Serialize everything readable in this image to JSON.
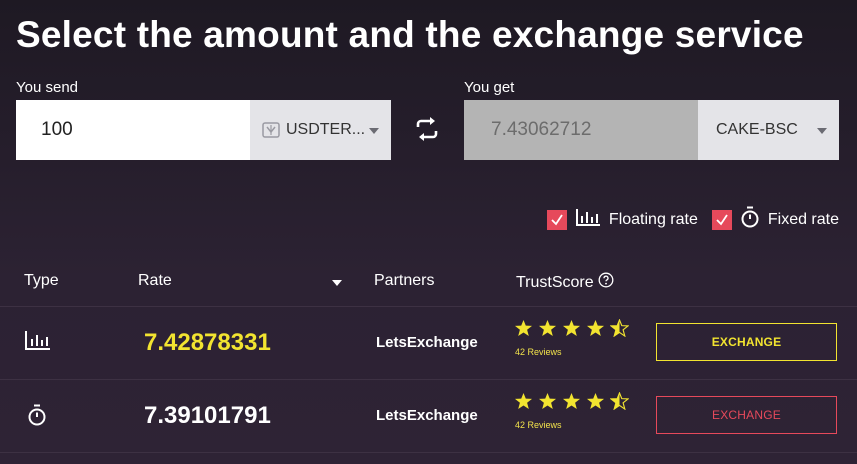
{
  "title": "Select the amount and the exchange service",
  "send": {
    "label": "You send",
    "value": "100",
    "currency": "USDTER...",
    "currency_icon": "usdt-token-icon"
  },
  "get": {
    "label": "You get",
    "value": "7.43062712",
    "currency": "CAKE-BSC"
  },
  "swap_icon": "swap-arrows-icon",
  "filters": [
    {
      "label": "Floating rate",
      "checked": true,
      "icon": "bar-chart-icon"
    },
    {
      "label": "Fixed rate",
      "checked": true,
      "icon": "stopwatch-icon"
    }
  ],
  "table": {
    "headers": {
      "type": "Type",
      "rate": "Rate",
      "partners": "Partners",
      "trustscore": "TrustScore"
    },
    "rows": [
      {
        "type_icon": "bar-chart-icon",
        "rate": "7.42878331",
        "partner": "LetsExchange",
        "stars": 4.5,
        "reviews": "42 Reviews",
        "button": "EXCHANGE"
      },
      {
        "type_icon": "stopwatch-icon",
        "rate": "7.39101791",
        "partner": "LetsExchange",
        "stars": 4.5,
        "reviews": "42 Reviews",
        "button": "EXCHANGE"
      }
    ]
  },
  "colors": {
    "accent_yellow": "#f2e430",
    "accent_red": "#e6495b",
    "background": "#2a2130"
  }
}
